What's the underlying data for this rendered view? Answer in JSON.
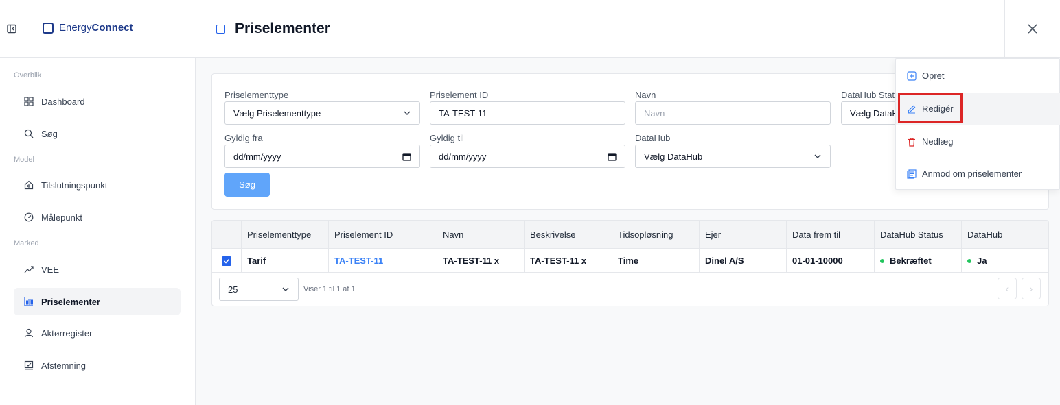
{
  "brand": {
    "name_light": "Energy",
    "name_bold": "Connect"
  },
  "page": {
    "title": "Priselementer"
  },
  "sidebar": {
    "sections": [
      "Overblik",
      "Model",
      "Marked"
    ],
    "items": [
      {
        "label": "Dashboard",
        "icon": "dashboard-icon"
      },
      {
        "label": "Søg",
        "icon": "search-icon"
      },
      {
        "label": "Tilslutningspunkt",
        "icon": "house-icon"
      },
      {
        "label": "Målepunkt",
        "icon": "gauge-icon"
      },
      {
        "label": "VEE",
        "icon": "trend-icon"
      },
      {
        "label": "Priselementer",
        "icon": "price-chart-icon",
        "active": true
      },
      {
        "label": "Aktørregister",
        "icon": "user-icon"
      },
      {
        "label": "Afstemning",
        "icon": "reconcile-icon"
      }
    ]
  },
  "filters": {
    "type": {
      "label": "Priselementtype",
      "value": "Vælg Priselementtype"
    },
    "id": {
      "label": "Priselement ID",
      "value": "TA-TEST-11"
    },
    "name": {
      "label": "Navn",
      "placeholder": "Navn"
    },
    "status": {
      "label": "DataHub Status",
      "value": "Vælg DataHu"
    },
    "from": {
      "label": "Gyldig fra",
      "value": "dd/mm/yyyy"
    },
    "to": {
      "label": "Gyldig til",
      "value": "dd/mm/yyyy"
    },
    "datahub": {
      "label": "DataHub",
      "value": "Vælg DataHub"
    },
    "search_label": "Søg"
  },
  "table": {
    "headers": [
      "Priselementtype",
      "Priselement ID",
      "Navn",
      "Beskrivelse",
      "Tidsopløsning",
      "Ejer",
      "Data frem til",
      "DataHub Status",
      "DataHub"
    ],
    "rows": [
      {
        "type": "Tarif",
        "id": "TA-TEST-11",
        "name": "TA-TEST-11 x",
        "description": "TA-TEST-11 x",
        "resolution": "Time",
        "owner": "Dinel A/S",
        "data_until": "01-01-10000",
        "status": "Bekræftet",
        "datahub": "Ja",
        "checked": true
      }
    ],
    "page_size": "25",
    "info": "Viser 1 til 1 af 1"
  },
  "menu": {
    "items": [
      {
        "label": "Opret",
        "icon": "plus-square-icon"
      },
      {
        "label": "Redigér",
        "icon": "pencil-icon"
      },
      {
        "label": "Nedlæg",
        "icon": "trash-icon"
      },
      {
        "label": "Anmod om priselementer",
        "icon": "document-icon"
      }
    ]
  },
  "colors": {
    "accent": "#2563eb",
    "button": "#60a5fa",
    "danger": "#dc2626",
    "success": "#22c55e",
    "brand": "#1e3a8a"
  }
}
